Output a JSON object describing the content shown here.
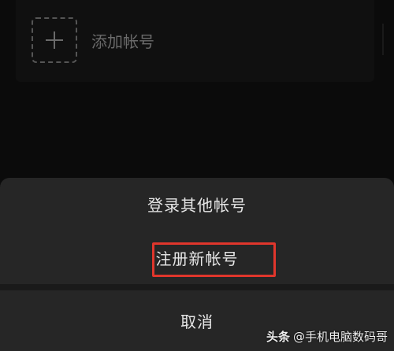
{
  "account_list": {
    "add_account_label": "添加帐号"
  },
  "bottom_sheet": {
    "login_other_label": "登录其他帐号",
    "register_label": "注册新帐号",
    "cancel_label": "取消"
  },
  "annotation": {
    "highlight_color": "#e0362c"
  },
  "watermark": {
    "brand": "头条",
    "author": "@手机电脑数码哥"
  }
}
